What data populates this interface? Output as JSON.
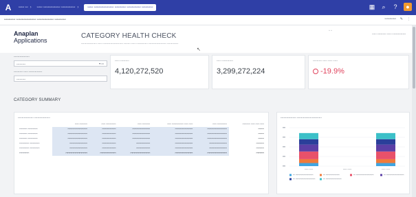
{
  "topbar": {
    "logo": "A",
    "crumbs": [
      "ꟷꟷ ꟷ",
      "ꟷꟷ ꟷꟷꟷꟷꟷꟷ ꟷꟷꟷꟷꟷ",
      "ꟷꟷ ꟷꟷꟷꟷꟷꟷꟷ ꟷꟷꟷꟷ ꟷꟷꟷꟷꟷ ꟷꟷꟷꟷ"
    ],
    "icons": [
      "grid-icon",
      "search-icon",
      "help-icon",
      "user-icon"
    ]
  },
  "subbar": {
    "page_name": "ꟷꟷꟷꟷ ꟷꟷꟷꟷꟷꟷꟷ ꟷꟷꟷꟷꟷꟷ ꟷꟷꟷꟷ",
    "right": "ꟷꟷꟷꟷ"
  },
  "header": {
    "brand_line1": "Anaplan",
    "brand_line2": "Applications",
    "title": "CATEGORY HEALTH CHECK",
    "subtitle": "ꟷꟷꟷꟷꟷꟷꟷ ꟷꟷ ꟷꟷꟷꟷꟷꟷꟷꟷꟷ ꟷꟷꟷ ꟷꟷ ꟷꟷꟷꟷꟷ ꟷꟷꟷꟷꟷꟷꟷꟷ ꟷꟷꟷꟷꟷ",
    "right_text": "ꟷꟷ ꟷꟷꟷꟷ ꟷꟷ ꟷꟷꟷꟷꟷꟷ"
  },
  "filters": {
    "f1_label": "ꟷꟷꟷꟷꟷꟷꟷ",
    "f1_value": "ꟷꟷꟷꟷ",
    "f2_label": "ꟷꟷꟷꟷ ꟷꟷ ꟷꟷꟷꟷꟷꟷ",
    "f2_value": "ꟷꟷꟷꟷ"
  },
  "kpis": [
    {
      "label": "ꟷꟷ ꟷꟷꟷꟷ",
      "value": "4,120,272,520"
    },
    {
      "label": "ꟷꟷ ꟷꟷꟷꟷꟷ",
      "value": "3,299,272,224"
    },
    {
      "label": "ꟷꟷꟷꟷ ꟷꟷ ꟷꟷ ꟷꟷ",
      "value": "-19.9%"
    }
  ],
  "section_title": "CATEGORY SUMMARY",
  "table": {
    "panel_title": "ꟷꟷꟷꟷꟷꟷꟷ ꟷꟷꟷꟷꟷꟷꟷ",
    "headers": [
      "",
      "ꟷꟷ ꟷꟷꟷꟷ",
      "ꟷꟷ ꟷꟷꟷꟷꟷ",
      "ꟷꟷ ꟷꟷꟷꟷ",
      "ꟷꟷ ꟷꟷꟷꟷꟷꟷ ꟷꟷ ꟷꟷ",
      "ꟷꟷ ꟷꟷꟷꟷꟷ",
      "ꟷꟷꟷꟷ ꟷꟷ ꟷꟷ ꟷꟷ"
    ],
    "rows": [
      [
        "ꟷꟷꟷꟷ ꟷꟷꟷꟷꟷ",
        "ꟷꟷꟷꟷꟷꟷꟷꟷꟷꟷ",
        "ꟷꟷꟷꟷꟷꟷꟷ",
        "ꟷꟷꟷꟷꟷꟷꟷꟷꟷ",
        "ꟷꟷꟷꟷꟷꟷꟷꟷꟷ",
        "ꟷꟷꟷꟷꟷꟷꟷꟷꟷꟷ",
        "ꟷꟷꟷ"
      ],
      [
        "ꟷꟷꟷꟷ ꟷꟷꟷꟷꟷ",
        "ꟷꟷꟷꟷꟷꟷꟷꟷꟷꟷ",
        "ꟷꟷꟷꟷꟷꟷꟷ",
        "ꟷꟷꟷꟷꟷꟷꟷꟷꟷ",
        "ꟷꟷꟷꟷꟷꟷꟷꟷꟷ",
        "ꟷꟷꟷꟷꟷꟷꟷꟷꟷꟷ",
        "ꟷꟷꟷ"
      ],
      [
        "ꟷꟷꟷꟷ ꟷꟷꟷꟷꟷ",
        "ꟷꟷꟷꟷꟷꟷꟷꟷꟷꟷ",
        "ꟷꟷꟷꟷꟷꟷꟷ",
        "ꟷꟷꟷꟷꟷꟷꟷꟷꟷ",
        "ꟷꟷꟷꟷꟷꟷꟷꟷꟷ",
        "ꟷꟷꟷꟷꟷꟷꟷꟷꟷꟷ",
        "ꟷꟷꟷ"
      ],
      [
        "ꟷꟷꟷꟷꟷ ꟷꟷꟷꟷꟷ",
        "ꟷꟷꟷꟷꟷꟷꟷꟷꟷ",
        "ꟷꟷꟷꟷꟷꟷꟷ",
        "ꟷꟷꟷꟷꟷꟷꟷ",
        "ꟷꟷꟷꟷꟷꟷꟷꟷꟷ",
        "ꟷꟷꟷꟷꟷꟷꟷꟷꟷ",
        "ꟷꟷꟷꟷ"
      ],
      [
        "ꟷꟷꟷꟷꟷ ꟷꟷꟷꟷꟷ",
        "ꟷꟷꟷꟷꟷꟷꟷꟷꟷ",
        "ꟷꟷꟷꟷꟷꟷꟷ",
        "ꟷꟷꟷꟷꟷꟷꟷ",
        "ꟷꟷꟷꟷꟷꟷꟷꟷꟷ",
        "ꟷꟷꟷꟷꟷꟷꟷꟷꟷ",
        "ꟷꟷꟷꟷ"
      ],
      [
        "ꟷꟷꟷꟷꟷ",
        "ꟷꟷꟷꟷꟷꟷꟷꟷꟷꟷꟷ",
        "ꟷꟷꟷꟷꟷꟷꟷꟷ",
        "ꟷꟷꟷꟷꟷꟷꟷꟷꟷꟷ",
        "ꟷꟷꟷꟷꟷꟷꟷꟷꟷ",
        "ꟷꟷꟷꟷꟷꟷꟷꟷꟷꟷ",
        "ꟷꟷꟷꟷ"
      ]
    ]
  },
  "chart_data": {
    "type": "bar",
    "stacked": true,
    "title": "ꟷꟷꟷꟷꟷꟷꟷ ꟷꟷꟷꟷꟷꟷꟷꟷꟷꟷꟷ",
    "categories": [
      "ꟷꟷ ꟷꟷ",
      "ꟷꟷ ꟷꟷ",
      "ꟷꟷ ꟷꟷ"
    ],
    "ylim": [
      0,
      100
    ],
    "grid": true,
    "legend_position": "bottom",
    "series": [
      {
        "name": "ꟷ ꟷꟷꟷꟷꟷꟷꟷꟷꟷ",
        "color": "#3fa5e0",
        "values": [
          8,
          0,
          8
        ]
      },
      {
        "name": "ꟷ ꟷꟷꟷꟷꟷꟷꟷ",
        "color": "#f07a3a",
        "values": [
          10,
          0,
          10
        ]
      },
      {
        "name": "ꟷ ꟷꟷꟷꟷꟷꟷꟷꟷꟷ",
        "color": "#e8516a",
        "values": [
          20,
          0,
          20
        ]
      },
      {
        "name": "ꟷ ꟷꟷꟷꟷꟷꟷꟷꟷꟷ",
        "color": "#5b3fa6",
        "values": [
          18,
          0,
          18
        ]
      },
      {
        "name": "ꟷ ꟷꟷꟷꟷꟷꟷꟷꟷꟷꟷ",
        "color": "#2a3f9a",
        "values": [
          14,
          0,
          14
        ]
      },
      {
        "name": "ꟷ ꟷꟷꟷꟷꟷꟷꟷꟷ",
        "color": "#3cc0c8",
        "values": [
          16,
          0,
          16
        ]
      }
    ]
  },
  "colors": {
    "topbar": "#2f3fa6",
    "negative": "#e0425c",
    "accent_orange": "#f19a2e"
  }
}
